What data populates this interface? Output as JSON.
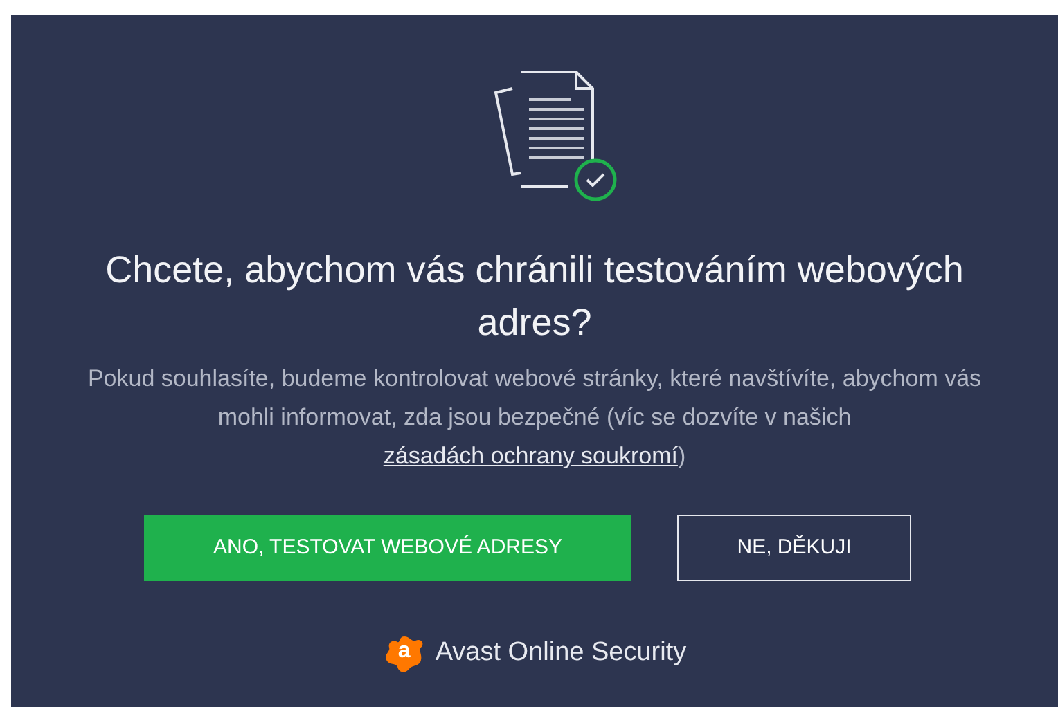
{
  "title": "Chcete, abychom vás chránili testováním webových adres?",
  "description": {
    "text": "Pokud souhlasíte, budeme kontrolovat webové stránky, které navštívíte, abychom vás mohli informovat, zda jsou bezpečné (víc se dozvíte v našich ",
    "link": "zásadách ochrany soukromí",
    "after": ")"
  },
  "buttons": [
    {
      "label": "ANO, TESTOVAT WEBOVÉ ADRESY",
      "kind": "primary"
    },
    {
      "label": "NE, DĚKUJI",
      "kind": "secondary"
    }
  ],
  "footer": {
    "logo_letter": "a",
    "product": "Avast Online Security"
  }
}
